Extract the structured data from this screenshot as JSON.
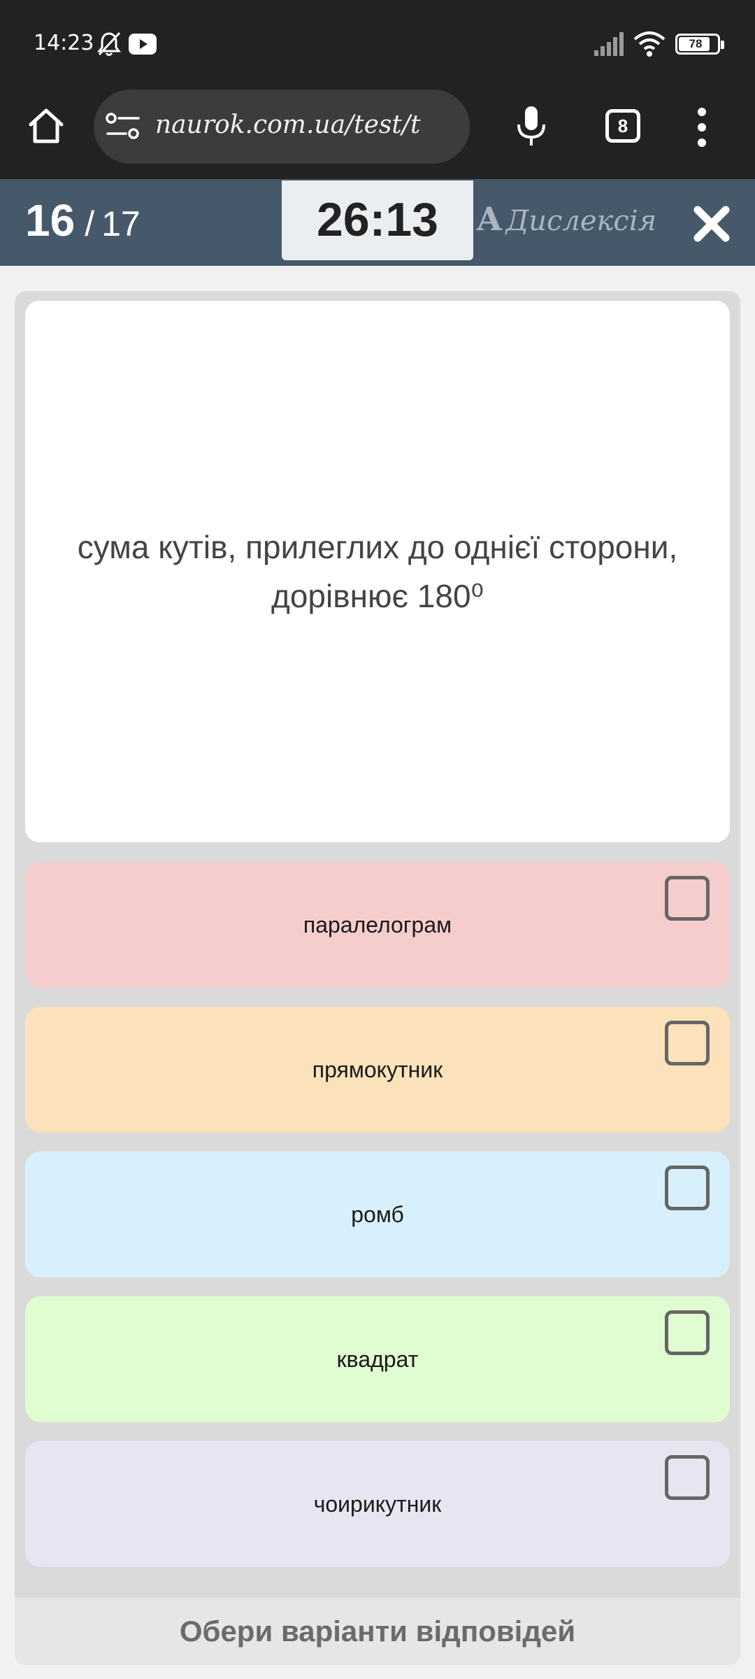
{
  "status_bar": {
    "time": "14:23",
    "icons": [
      "bell-off-icon",
      "youtube-icon",
      "signal-icon",
      "wifi-icon",
      "battery-icon"
    ],
    "battery_level": "78"
  },
  "browser": {
    "url": "naurok.com.ua/test/t",
    "tab_count": "8",
    "icons": [
      "home-icon",
      "site-settings-icon",
      "mic-icon",
      "tabs-icon",
      "more-vert-icon"
    ]
  },
  "test_header": {
    "current_question": "16",
    "separator": "/",
    "total_questions": "17",
    "timer": "26:13",
    "dyslexia_glyph": "A",
    "dyslexia_label": "Дислексія",
    "close_icon": "close-icon",
    "background_color": "#46596b"
  },
  "question": {
    "text": "сума кутів, прилеглих до однієї сторони, дорівнює 180⁰"
  },
  "options": [
    {
      "label": "паралелограм",
      "color": "#f6cdcd",
      "checked": false
    },
    {
      "label": "прямокутник",
      "color": "#fbe2bb",
      "checked": false
    },
    {
      "label": "ромб",
      "color": "#d8f0fb",
      "checked": false
    },
    {
      "label": "квадрат",
      "color": "#e0fcd1",
      "checked": false
    },
    {
      "label": "чоирикутник",
      "color": "#e6e6f2",
      "checked": false
    }
  ],
  "submit": {
    "label": "Обери варіанти відповідей"
  }
}
